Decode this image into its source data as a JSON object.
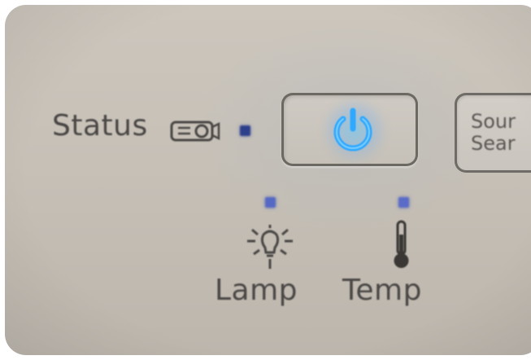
{
  "labels": {
    "status": "Status",
    "lamp": "Lamp",
    "temp": "Temp",
    "source_line1": "Sour",
    "source_line2": "Sear"
  },
  "icons": {
    "projector": "projector-icon",
    "power": "power-icon",
    "lamp": "lamp-bulb-icon",
    "temp": "thermometer-icon"
  },
  "colors": {
    "panel": "#c6c0b7",
    "label_text": "#4a4745",
    "power_glow": "#3fb6ff",
    "indicator_led": "#5468c4"
  }
}
